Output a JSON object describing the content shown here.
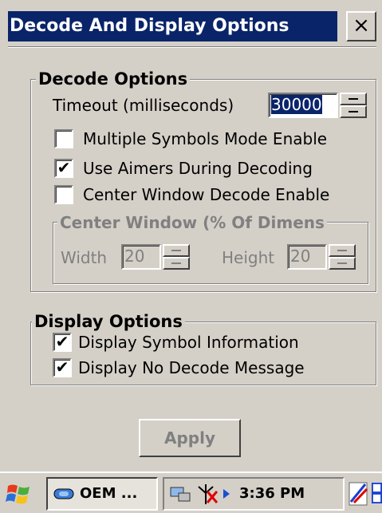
{
  "window": {
    "title": "Decode And Display Options",
    "close_symbol": "×"
  },
  "decode_options": {
    "group_label": "Decode Options",
    "timeout_label": "Timeout (milliseconds)",
    "timeout_value": "30000",
    "multiple_symbols_label": "Multiple Symbols Mode Enable",
    "multiple_symbols_checked": false,
    "use_aimers_label": "Use Aimers During Decoding",
    "use_aimers_checked": true,
    "center_window_label": "Center Window Decode Enable",
    "center_window_checked": false,
    "center_window_group": {
      "label": "Center Window (% Of Dimens",
      "width_label": "Width",
      "width_value": "20",
      "height_label": "Height",
      "height_value": "20"
    }
  },
  "display_options": {
    "group_label": "Display Options",
    "symbol_info_label": "Display Symbol Information",
    "symbol_info_checked": true,
    "no_decode_label": "Display No Decode Message",
    "no_decode_checked": true
  },
  "apply_label": "Apply",
  "taskbar": {
    "task_label": "OEM ...",
    "clock": "3:36 PM",
    "check_symbol": "✔"
  },
  "icons": [
    "windows-start-icon",
    "oem-app-icon",
    "network-icon",
    "antenna-disconnected-icon",
    "input-panel-icon",
    "switch-windows-icon"
  ]
}
